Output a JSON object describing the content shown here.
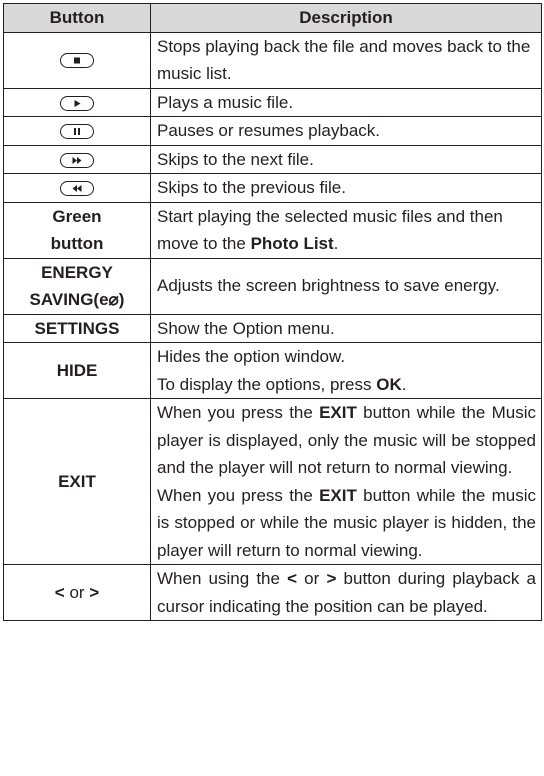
{
  "header": {
    "col_button": "Button",
    "col_description": "Description"
  },
  "rows": {
    "stop": {
      "icon": "stop-icon",
      "desc": "Stops playing back the file and moves back to the music list."
    },
    "play": {
      "icon": "play-icon",
      "desc": "Plays a music file."
    },
    "pause": {
      "icon": "pause-icon",
      "desc": "Pauses or resumes playback."
    },
    "next": {
      "icon": "fast-forward-icon",
      "desc": "Skips to the next file."
    },
    "prev": {
      "icon": "rewind-icon",
      "desc": "Skips to the previous file."
    },
    "green": {
      "label_line1": "Green",
      "label_line2": "button",
      "desc_pre": "Start playing the selected music files and then move to the ",
      "desc_bold": "Photo List",
      "desc_post": "."
    },
    "energy": {
      "label_line1": "ENERGY",
      "label_line2_pre": "SAVING(",
      "label_glyph": "e⌀",
      "label_line2_post": ")",
      "desc": "Adjusts the screen brightness to save energy."
    },
    "settings": {
      "label": "SETTINGS",
      "desc": "Show the Option menu."
    },
    "hide": {
      "label": "HIDE",
      "desc_line1": "Hides the option window.",
      "desc_line2_pre": "To display the options, press ",
      "desc_line2_bold": "OK",
      "desc_line2_post": "."
    },
    "exit": {
      "label": "EXIT",
      "p1_pre": "When you press the ",
      "p1_bold": "EXIT",
      "p1_post": " button while the Music player is displayed, only the music will be stopped and the player will not return to normal viewing.",
      "p2_pre": "When you press the ",
      "p2_bold": "EXIT",
      "p2_post": " button while the music is stopped or while the music player is hidden, the player will return to normal viewing."
    },
    "arrows": {
      "label_lt": "<",
      "label_or": " or ",
      "label_gt": ">",
      "desc_pre": "When using the ",
      "desc_lt": "<",
      "desc_or": " or ",
      "desc_gt": ">",
      "desc_post": " button during playback a cursor indicating the position can be played."
    }
  }
}
